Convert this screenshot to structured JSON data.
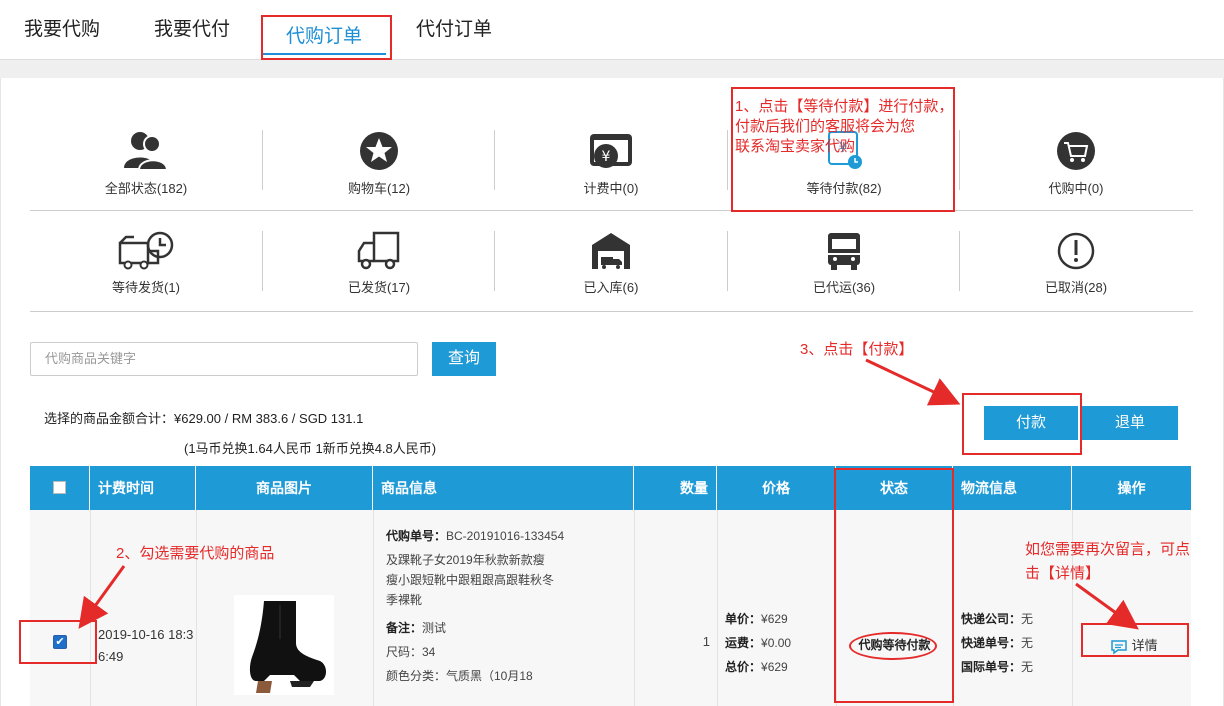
{
  "tabs": [
    "我要代购",
    "我要代付",
    "代购订单",
    "代付订单"
  ],
  "status_row1": [
    {
      "icon": "users-icon",
      "label": "全部状态(182)"
    },
    {
      "icon": "star-icon",
      "label": "购物车(12)"
    },
    {
      "icon": "yen-bill-icon",
      "label": "计费中(0)"
    },
    {
      "icon": "pay-clock-icon",
      "label": "等待付款(82)"
    },
    {
      "icon": "cart-icon",
      "label": "代购中(0)"
    }
  ],
  "status_row2": [
    {
      "icon": "truck-clock-icon",
      "label": "等待发货(1)"
    },
    {
      "icon": "truck-icon",
      "label": "已发货(17)"
    },
    {
      "icon": "warehouse-icon",
      "label": "已入库(6)"
    },
    {
      "icon": "bus-icon",
      "label": "已代运(36)"
    },
    {
      "icon": "exclaim-icon",
      "label": "已取消(28)"
    }
  ],
  "search": {
    "placeholder": "代购商品关键字",
    "button": "查询"
  },
  "summary": {
    "line1": "选择的商品金额合计：¥629.00  / RM 383.6  / SGD 131.1",
    "line2": "(1马币兑换1.64人民币 1新币兑换4.8人民币)"
  },
  "actions": {
    "pay": "付款",
    "cancel": "退单"
  },
  "table": {
    "headers": [
      "计费时间",
      "商品图片",
      "商品信息",
      "数量",
      "价格",
      "状态",
      "物流信息",
      "操作"
    ],
    "row": {
      "time": "2019-10-16 18:36:49",
      "info": {
        "order_label": "代购单号：",
        "order_no": "BC-20191016-133454",
        "title": "及踝靴子女2019年秋款新款瘦瘦小跟短靴中跟粗跟高跟鞋秋冬季裸靴",
        "note_label": "备注：",
        "note": "测试",
        "size": "尺码：34",
        "color": "颜色分类：气质黑（10月18"
      },
      "qty": "1",
      "price": {
        "unit_label": "单价：",
        "unit": "¥629",
        "ship_label": "运费：",
        "ship": "¥0.00",
        "total_label": "总价：",
        "total": "¥629"
      },
      "status": "代购等待付款",
      "logistics": {
        "company_label": "快递公司：",
        "company": "无",
        "tracking_label": "快递单号：",
        "tracking": "无",
        "intl_label": "国际单号：",
        "intl": "无"
      },
      "op": "详情"
    }
  },
  "annotations": {
    "a1": "1、点击【等待付款】进行付款，\n付款后我们的客服将会为您\n联系淘宝卖家代购",
    "a2": "2、勾选需要代购的商品",
    "a3": "3、点击【付款】",
    "a4": "如您需要再次留言，可点\n击【详情】"
  },
  "colors": {
    "accent": "#1e9ad6",
    "annotation": "#e52a2a"
  }
}
